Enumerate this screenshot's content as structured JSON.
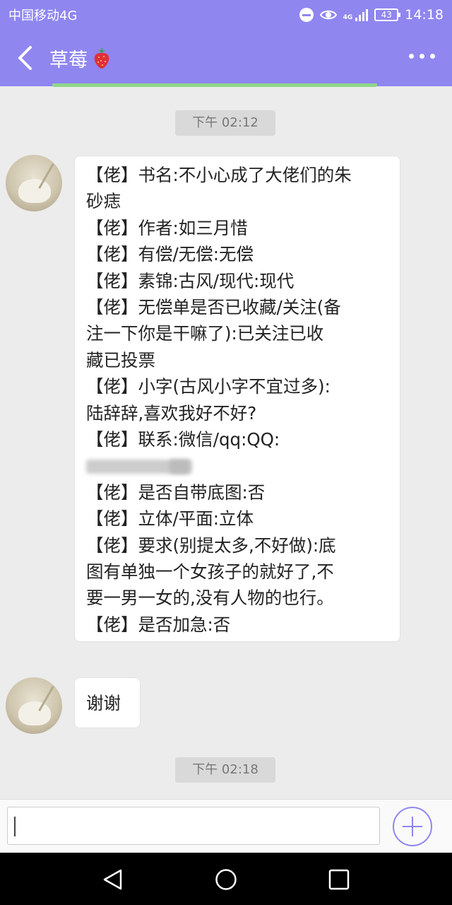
{
  "status_bar": {
    "carrier": "中国移动4G",
    "network_label": "4G",
    "battery": "43",
    "time": "14:18"
  },
  "header": {
    "title": "草莓",
    "title_emoji_icon": "strawberry-icon",
    "accent_color": "#8f86f0"
  },
  "messages": [
    {
      "timestamp": "下午 02:12",
      "lines": [
        "【佬】书名:不小心成了大佬们的朱",
        "砂痣",
        "【佬】作者:如三月惜",
        "【佬】有偿/无偿:无偿",
        "【佬】素锦:古风/现代:现代",
        "【佬】无偿单是否已收藏/关注(备",
        "注一下你是干嘛了):已关注已收",
        "藏已投票",
        "【佬】小字(古风小字不宜过多):",
        "陆辞辞,喜欢我好不好?",
        "【佬】联系:微信/qq:QQ:",
        "",
        "【佬】是否自带底图:否",
        "【佬】立体/平面:立体",
        "【佬】要求(别提太多,不好做):底",
        "图有单独一个女孩子的就好了,不",
        "要一男一女的,没有人物的也行。",
        "【佬】是否加急:否"
      ]
    },
    {
      "text": "谢谢"
    },
    {
      "timestamp": "下午 02:18"
    }
  ],
  "input": {
    "placeholder": ""
  }
}
